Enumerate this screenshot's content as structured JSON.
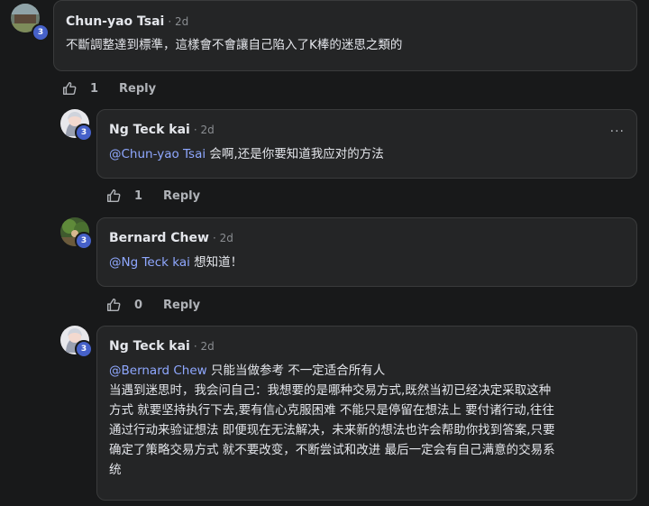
{
  "comments": [
    {
      "author": "Chun-yao Tsai",
      "time": "· 2d",
      "level": "3",
      "mention": "",
      "text": "不斷調整達到標準，這樣會不會讓自己陷入了K棒的迷思之類的",
      "likes": "1",
      "reply_label": "Reply"
    },
    {
      "author": "Ng Teck kai",
      "time": "· 2d",
      "level": "3",
      "mention": "@Chun-yao Tsai",
      "text": " 会啊,还是你要知道我应对的方法",
      "likes": "1",
      "reply_label": "Reply",
      "more_label": "···"
    },
    {
      "author": "Bernard Chew",
      "time": "· 2d",
      "level": "3",
      "mention": "@Ng Teck kai",
      "text": " 想知道！",
      "likes": "0",
      "reply_label": "Reply"
    },
    {
      "author": "Ng Teck kai",
      "time": "· 2d",
      "level": "3",
      "mention": "@Bernard Chew",
      "text": " 只能当做参考 不一定适合所有人",
      "lines": [
        "当遇到迷思时，我会问自己：我想要的是哪种交易方式,既然当初已经决定采取这种",
        "方式 就要坚持执行下去,要有信心克服困难 不能只是停留在想法上 要付诸行动,往往",
        "通过行动来验证想法 即便现在无法解决，未来新的想法也许会帮助你找到答案,只要",
        "确定了策略交易方式 就不要改变，不断尝试和改进 最后一定会有自己满意的交易系",
        "统"
      ]
    }
  ]
}
